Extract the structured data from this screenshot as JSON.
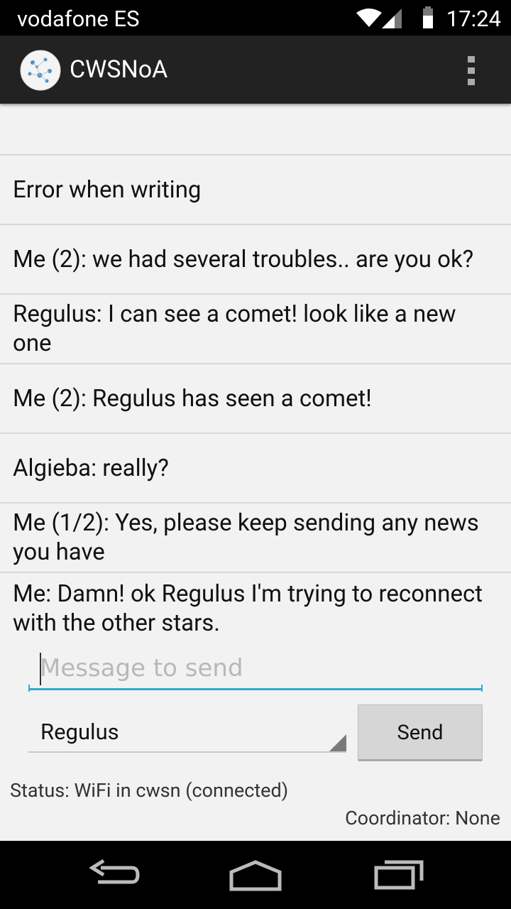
{
  "status_bar": {
    "carrier": "vodafone ES",
    "time": "17:24"
  },
  "action_bar": {
    "title": "CWSNoA",
    "logo_icon": "constellation-globe-icon",
    "overflow_icon": "overflow-menu-icon"
  },
  "messages": [
    "Error when writing",
    "Me (2): we had several troubles.. are you ok?",
    "Regulus: I can see a comet! look like a new one",
    "Me (2): Regulus has seen a comet!",
    "Algieba: really?",
    "Me (1/2): Yes, please keep sending any news you have",
    "Me: Damn! ok Regulus I'm trying to reconnect with the other stars."
  ],
  "compose": {
    "placeholder": "Message to send",
    "value": ""
  },
  "recipient": {
    "selected": "Regulus"
  },
  "send_label": "Send",
  "status_text": "Status: WiFi in cwsn (connected)",
  "coordinator_text": "Coordinator: None",
  "colors": {
    "accent": "#33a9cf",
    "action_bar": "#222222",
    "background": "#f2f2f2"
  }
}
